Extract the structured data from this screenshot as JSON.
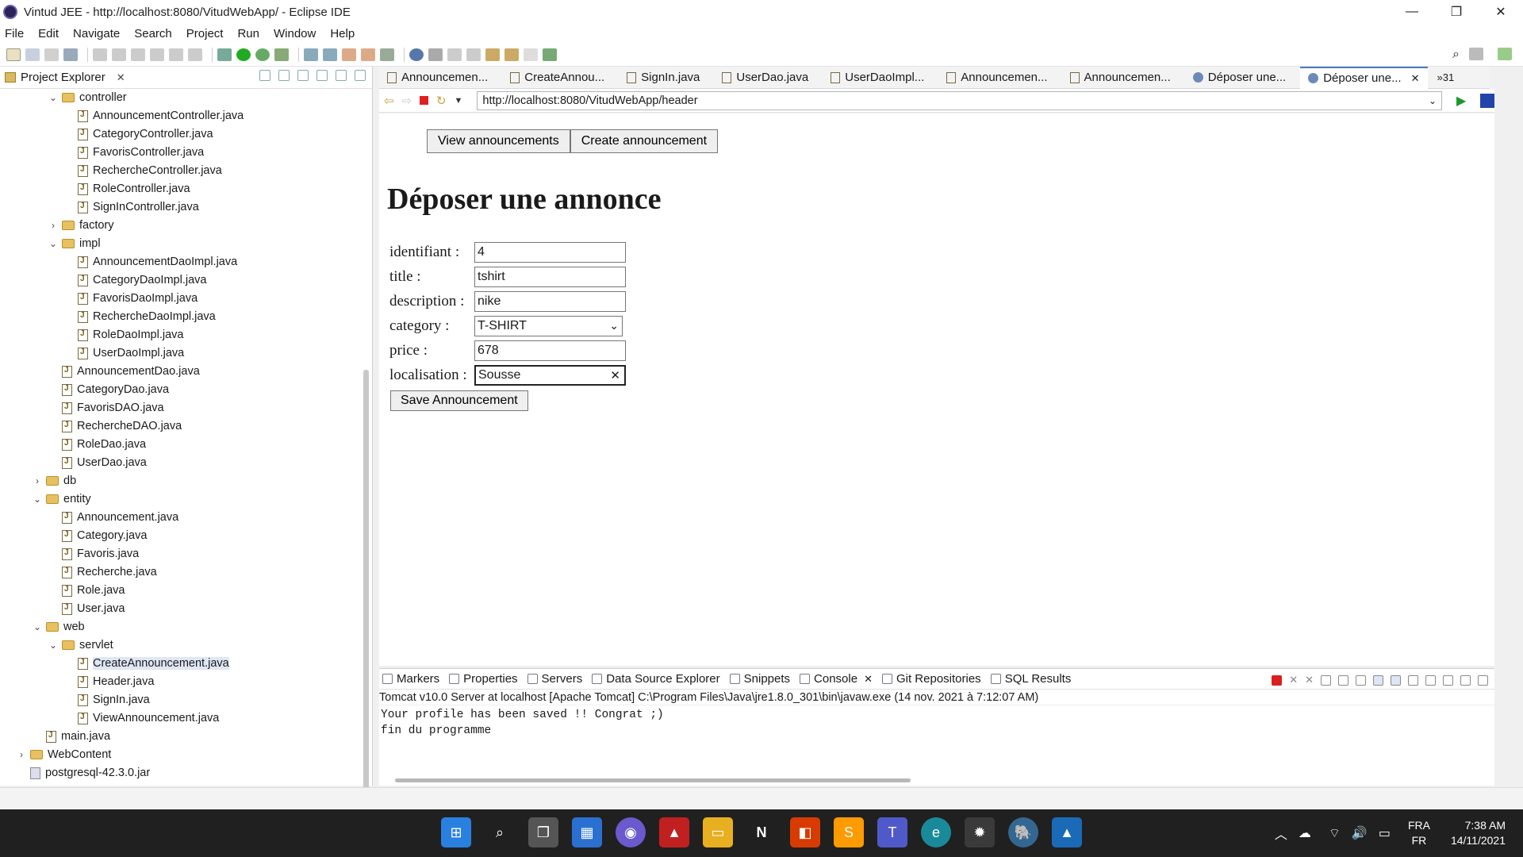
{
  "window": {
    "title": "Vintud JEE - http://localhost:8080/VitudWebApp/ - Eclipse IDE",
    "controls": [
      "—",
      "❐",
      "✕"
    ]
  },
  "menu": [
    "File",
    "Edit",
    "Navigate",
    "Search",
    "Project",
    "Run",
    "Window",
    "Help"
  ],
  "project_explorer": {
    "tab_label": "Project Explorer",
    "items": [
      {
        "label": "controller",
        "kind": "folder",
        "depth": 3,
        "expanded": true
      },
      {
        "label": "AnnouncementController.java",
        "kind": "java",
        "depth": 4
      },
      {
        "label": "CategoryController.java",
        "kind": "java",
        "depth": 4
      },
      {
        "label": "FavorisController.java",
        "kind": "java",
        "depth": 4
      },
      {
        "label": "RechercheController.java",
        "kind": "java",
        "depth": 4
      },
      {
        "label": "RoleController.java",
        "kind": "java",
        "depth": 4
      },
      {
        "label": "SignInController.java",
        "kind": "java",
        "depth": 4
      },
      {
        "label": "factory",
        "kind": "folder",
        "depth": 3,
        "expanded": false
      },
      {
        "label": "impl",
        "kind": "folder",
        "depth": 3,
        "expanded": true
      },
      {
        "label": "AnnouncementDaoImpl.java",
        "kind": "java",
        "depth": 4
      },
      {
        "label": "CategoryDaoImpl.java",
        "kind": "java",
        "depth": 4
      },
      {
        "label": "FavorisDaoImpl.java",
        "kind": "java",
        "depth": 4
      },
      {
        "label": "RechercheDaoImpl.java",
        "kind": "java",
        "depth": 4
      },
      {
        "label": "RoleDaoImpl.java",
        "kind": "java",
        "depth": 4
      },
      {
        "label": "UserDaoImpl.java",
        "kind": "java",
        "depth": 4
      },
      {
        "label": "AnnouncementDao.java",
        "kind": "java",
        "depth": 3
      },
      {
        "label": "CategoryDao.java",
        "kind": "java",
        "depth": 3
      },
      {
        "label": "FavorisDAO.java",
        "kind": "java",
        "depth": 3
      },
      {
        "label": "RechercheDAO.java",
        "kind": "java",
        "depth": 3
      },
      {
        "label": "RoleDao.java",
        "kind": "java",
        "depth": 3
      },
      {
        "label": "UserDao.java",
        "kind": "java",
        "depth": 3
      },
      {
        "label": "db",
        "kind": "folder",
        "depth": 2,
        "expanded": false
      },
      {
        "label": "entity",
        "kind": "folder",
        "depth": 2,
        "expanded": true
      },
      {
        "label": "Announcement.java",
        "kind": "java",
        "depth": 3
      },
      {
        "label": "Category.java",
        "kind": "java",
        "depth": 3
      },
      {
        "label": "Favoris.java",
        "kind": "java",
        "depth": 3
      },
      {
        "label": "Recherche.java",
        "kind": "java",
        "depth": 3
      },
      {
        "label": "Role.java",
        "kind": "java",
        "depth": 3
      },
      {
        "label": "User.java",
        "kind": "java",
        "depth": 3
      },
      {
        "label": "web",
        "kind": "folder",
        "depth": 2,
        "expanded": true
      },
      {
        "label": "servlet",
        "kind": "folder",
        "depth": 3,
        "expanded": true
      },
      {
        "label": "CreateAnnouncement.java",
        "kind": "java",
        "depth": 4,
        "selected": true
      },
      {
        "label": "Header.java",
        "kind": "java",
        "depth": 4
      },
      {
        "label": "SignIn.java",
        "kind": "java",
        "depth": 4
      },
      {
        "label": "ViewAnnouncement.java",
        "kind": "java",
        "depth": 4
      },
      {
        "label": "main.java",
        "kind": "java",
        "depth": 2
      },
      {
        "label": "WebContent",
        "kind": "folder",
        "depth": 1,
        "expanded": false
      },
      {
        "label": "postgresql-42.3.0.jar",
        "kind": "jar",
        "depth": 1
      }
    ]
  },
  "editor_tabs": [
    {
      "label": "Announcemen...",
      "type": "java"
    },
    {
      "label": "CreateAnnou...",
      "type": "java"
    },
    {
      "label": "SignIn.java",
      "type": "java"
    },
    {
      "label": "UserDao.java",
      "type": "java"
    },
    {
      "label": "UserDaoImpl...",
      "type": "java"
    },
    {
      "label": "Announcemen...",
      "type": "java"
    },
    {
      "label": "Announcemen...",
      "type": "java"
    },
    {
      "label": "Déposer une...",
      "type": "web"
    },
    {
      "label": "Déposer une...",
      "type": "web",
      "active": true
    }
  ],
  "editor_tabs_overflow": "»31",
  "browser": {
    "url": "http://localhost:8080/VitudWebApp/header"
  },
  "page": {
    "nav_view": "View announcements",
    "nav_create": "Create announcement",
    "heading": "Déposer une annonce",
    "form": {
      "identifiant_label": "identifiant :",
      "identifiant_value": "4",
      "title_label": "title :",
      "title_value": "tshirt",
      "description_label": "description :",
      "description_value": "nike",
      "category_label": "category :",
      "category_value": "T-SHIRT",
      "price_label": "price :",
      "price_value": "678",
      "localisation_label": "localisation :",
      "localisation_value": "Sousse",
      "save_label": "Save Announcement"
    }
  },
  "bottom_panel": {
    "tabs": [
      {
        "label": "Markers"
      },
      {
        "label": "Properties"
      },
      {
        "label": "Servers"
      },
      {
        "label": "Data Source Explorer"
      },
      {
        "label": "Snippets"
      },
      {
        "label": "Console",
        "active": true
      },
      {
        "label": "Git Repositories"
      },
      {
        "label": "SQL Results"
      }
    ],
    "console_info": "Tomcat v10.0 Server at localhost [Apache Tomcat] C:\\Program Files\\Java\\jre1.8.0_301\\bin\\javaw.exe  (14 nov. 2021 à 7:12:07 AM)",
    "console_lines": [
      "Your profile has been saved !! Congrat ;)",
      "fin du programme"
    ]
  },
  "taskbar": {
    "lang_top": "FRA",
    "lang_bottom": "FR",
    "time": "7:38 AM",
    "date": "14/11/2021"
  },
  "colors": {
    "accent": "#4a78c0",
    "taskbar": "#202020",
    "stop_red": "#e02020"
  }
}
